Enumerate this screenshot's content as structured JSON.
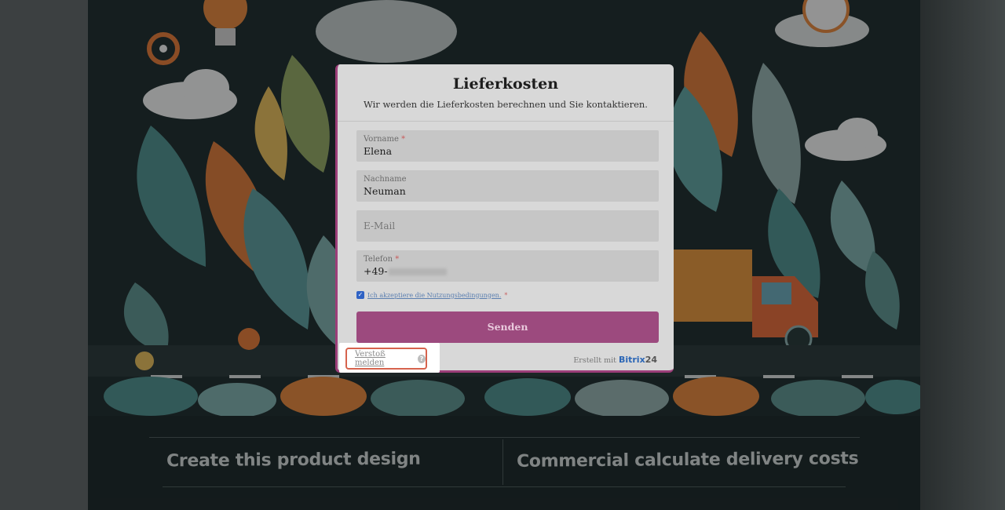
{
  "background": {
    "banner_left": "Create this product design",
    "banner_right": "Commercial calculate delivery costs"
  },
  "form": {
    "title": "Lieferkosten",
    "subtitle": "Wir werden die Lieferkosten berechnen und Sie kontaktieren.",
    "fields": [
      {
        "label": "Vorname",
        "required": "*",
        "value": "Elena"
      },
      {
        "label": "Nachname",
        "value": "Neuman"
      },
      {
        "placeholder": "E-Mail"
      },
      {
        "label": "Telefon",
        "required": "*",
        "value": "+49-"
      }
    ],
    "consent": {
      "text": "Ich akzeptiere die Nutzungsbedingungen.",
      "required": "*",
      "checked": true
    },
    "submit_label": "Senden",
    "credit_prefix": "Erstellt mit",
    "credit_brand": "Bitrix",
    "credit_brand_suffix": "24"
  },
  "report": {
    "label": "Verstoß melden",
    "help_icon": "?"
  },
  "colors": {
    "accent": "#9c4a7e",
    "highlight": "#d6634d",
    "link": "#2b66b6"
  }
}
